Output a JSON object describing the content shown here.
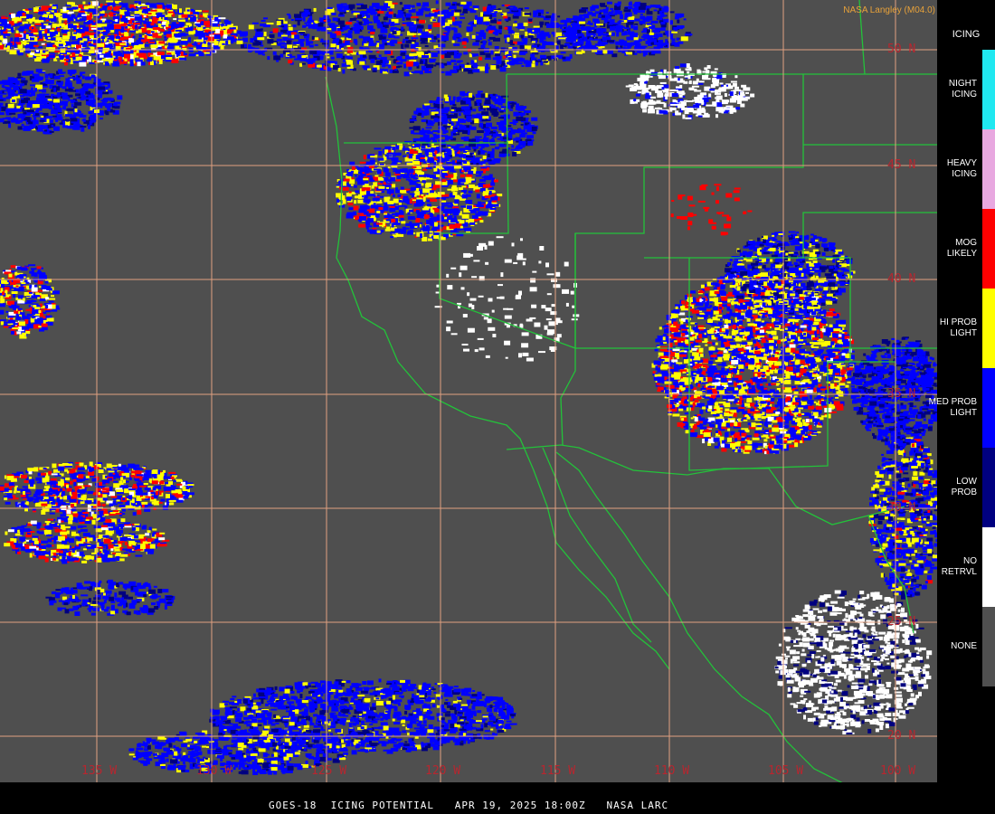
{
  "product": {
    "caption": "GOES-18  ICING POTENTIAL   APR 19, 2025 18:00Z   NASA LARC",
    "credit": "NASA Langley (M04.0)"
  },
  "legend": {
    "title": "ICING",
    "items": [
      {
        "lines": [
          "NIGHT",
          "ICING"
        ],
        "color": "#20e8f0"
      },
      {
        "lines": [
          "HEAVY",
          "ICING"
        ],
        "color": "#e8a8e0"
      },
      {
        "lines": [
          "MOG",
          "LIKELY"
        ],
        "color": "#ff0000"
      },
      {
        "lines": [
          "HI PROB",
          "LIGHT"
        ],
        "color": "#ffff00"
      },
      {
        "lines": [
          "MED PROB",
          "LIGHT"
        ],
        "color": "#0000ff"
      },
      {
        "lines": [
          "LOW",
          "PROB"
        ],
        "color": "#000080"
      },
      {
        "lines": [
          "NO",
          "RETRVL"
        ],
        "color": "#ffffff"
      },
      {
        "lines": [
          "NONE"
        ],
        "color": "#505050"
      }
    ]
  },
  "grid": {
    "latitudes": [
      "50 N",
      "45 N",
      "40 N",
      "35 N",
      "30 N",
      "25 N",
      "20 N"
    ],
    "longitudes": [
      "135 W",
      "130 W",
      "125 W",
      "120 W",
      "115 W",
      "110 W",
      "105 W",
      "100 W"
    ],
    "line_color": "#e0a080"
  },
  "colors": {
    "background": "#4f4f4f",
    "coastline": "#23c23a",
    "low_prob": "#000080",
    "med_prob": "#0000ff",
    "hi_prob": "#ffff00",
    "mog": "#ff0000",
    "no_retrieval": "#ffffff"
  }
}
